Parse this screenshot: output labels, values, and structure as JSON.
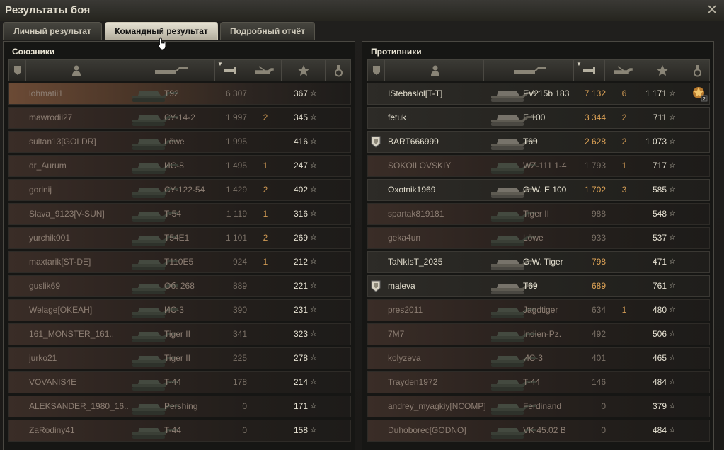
{
  "window": {
    "title": "Результаты боя"
  },
  "tabs": [
    {
      "label": "Личный результат",
      "active": false
    },
    {
      "label": "Командный результат",
      "active": true
    },
    {
      "label": "Подробный отчёт",
      "active": false
    }
  ],
  "allies": {
    "title": "Союзники",
    "rows": [
      {
        "name": "lohmatii1",
        "tank": "T92",
        "damage": "6 307",
        "frags": "",
        "xp": "367",
        "alive": false,
        "highlight": true
      },
      {
        "name": "mawrodii27",
        "tank": "СУ-14-2",
        "damage": "1 997",
        "frags": "2",
        "xp": "345",
        "alive": false
      },
      {
        "name": "sultan13[GOLDR]",
        "tank": "Löwe",
        "damage": "1 995",
        "frags": "",
        "xp": "416",
        "alive": false
      },
      {
        "name": "dr_Aurum",
        "tank": "ИС-8",
        "damage": "1 495",
        "frags": "1",
        "xp": "247",
        "alive": false
      },
      {
        "name": "gorinij",
        "tank": "СУ-122-54",
        "damage": "1 429",
        "frags": "2",
        "xp": "402",
        "alive": false
      },
      {
        "name": "Slava_9123[V-SUN]",
        "tank": "T-54",
        "damage": "1 119",
        "frags": "1",
        "xp": "316",
        "alive": false
      },
      {
        "name": "yurchik001",
        "tank": "T54E1",
        "damage": "1 101",
        "frags": "2",
        "xp": "269",
        "alive": false
      },
      {
        "name": "maxtarik[ST-DE]",
        "tank": "T110E5",
        "damage": "924",
        "frags": "1",
        "xp": "212",
        "alive": false
      },
      {
        "name": "guslik69",
        "tank": "Об. 268",
        "damage": "889",
        "frags": "",
        "xp": "221",
        "alive": false
      },
      {
        "name": "Welage[OKEAH]",
        "tank": "ИС-3",
        "damage": "390",
        "frags": "",
        "xp": "231",
        "alive": false
      },
      {
        "name": "161_MONSTER_161..",
        "tank": "Tiger II",
        "damage": "341",
        "frags": "",
        "xp": "323",
        "alive": false
      },
      {
        "name": "jurko21",
        "tank": "Tiger II",
        "damage": "225",
        "frags": "",
        "xp": "278",
        "alive": false
      },
      {
        "name": "VOVANIS4E",
        "tank": "T-44",
        "damage": "178",
        "frags": "",
        "xp": "214",
        "alive": false
      },
      {
        "name": "ALEKSANDER_1980_16..",
        "tank": "Pershing",
        "damage": "0",
        "frags": "",
        "xp": "171",
        "alive": false
      },
      {
        "name": "ZaRodiny41",
        "tank": "T-44",
        "damage": "0",
        "frags": "",
        "xp": "158",
        "alive": false
      }
    ]
  },
  "enemies": {
    "title": "Противники",
    "rows": [
      {
        "name": "IStebaslol[T-T]",
        "tank": "FV215b 183",
        "damage": "7 132",
        "frags": "6",
        "xp": "1 171",
        "alive": true,
        "medal": "2"
      },
      {
        "name": "fetuk",
        "tank": "E 100",
        "damage": "3 344",
        "frags": "2",
        "xp": "711",
        "alive": true
      },
      {
        "name": "BART666999",
        "tank": "T69",
        "damage": "2 628",
        "frags": "2",
        "xp": "1 073",
        "alive": true,
        "platoon": true
      },
      {
        "name": "SOKOILOVSKIY",
        "tank": "WZ-111 1-4",
        "damage": "1 793",
        "frags": "1",
        "xp": "717",
        "alive": false
      },
      {
        "name": "Oxotnik1969",
        "tank": "G.W. E 100",
        "damage": "1 702",
        "frags": "3",
        "xp": "585",
        "alive": true
      },
      {
        "name": "spartak819181",
        "tank": "Tiger II",
        "damage": "988",
        "frags": "",
        "xp": "548",
        "alive": false
      },
      {
        "name": "geka4un",
        "tank": "Löwe",
        "damage": "933",
        "frags": "",
        "xp": "537",
        "alive": false
      },
      {
        "name": "TaNkIsT_2035",
        "tank": "G.W. Tiger",
        "damage": "798",
        "frags": "",
        "xp": "471",
        "alive": true
      },
      {
        "name": "maleva",
        "tank": "T69",
        "damage": "689",
        "frags": "",
        "xp": "761",
        "alive": true,
        "platoon": true
      },
      {
        "name": "pres2011",
        "tank": "Jagdtiger",
        "damage": "634",
        "frags": "1",
        "xp": "480",
        "alive": false
      },
      {
        "name": "7M7",
        "tank": "Indien-Pz.",
        "damage": "492",
        "frags": "",
        "xp": "506",
        "alive": false
      },
      {
        "name": "kolyzeva",
        "tank": "ИС-3",
        "damage": "401",
        "frags": "",
        "xp": "465",
        "alive": false
      },
      {
        "name": "Trayden1972",
        "tank": "T-44",
        "damage": "146",
        "frags": "",
        "xp": "484",
        "alive": false
      },
      {
        "name": "andrey_myagkiy[NCOMP]",
        "tank": "Ferdinand",
        "damage": "0",
        "frags": "",
        "xp": "379",
        "alive": false
      },
      {
        "name": "Duhoborec[GODNO]",
        "tank": "VK 45.02 B",
        "damage": "0",
        "frags": "",
        "xp": "484",
        "alive": false
      }
    ]
  },
  "columns": [
    "squad-icon",
    "player-icon",
    "tank-icon",
    "damage-icon",
    "frags-icon",
    "xp-star-icon",
    "medal-icon"
  ],
  "colors": {
    "damage_alive": "#dfa457",
    "frags": "#d09a54",
    "active_tab": "#e6e2d3"
  }
}
